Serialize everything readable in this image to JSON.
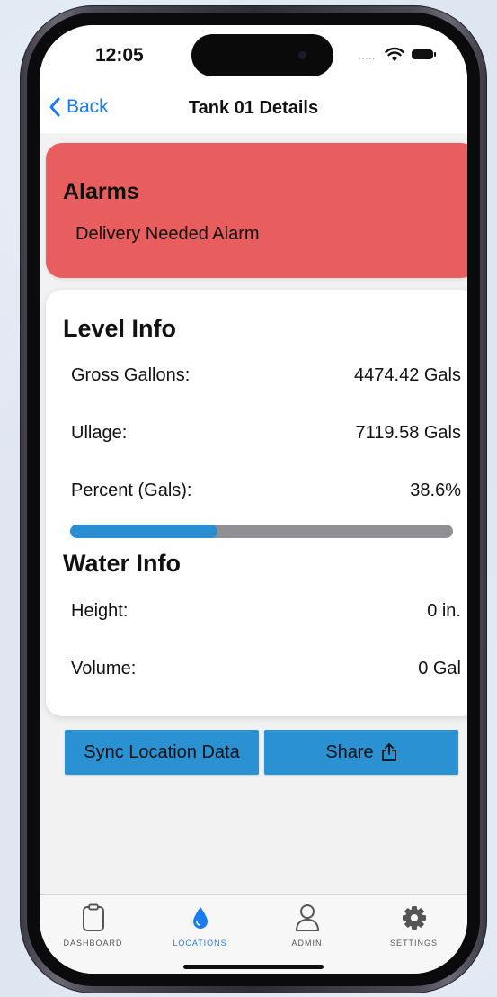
{
  "status_bar": {
    "time": "12:05",
    "signal_dots": "....."
  },
  "nav": {
    "back_label": "Back",
    "title": "Tank 01 Details"
  },
  "alarms": {
    "title": "Alarms",
    "items": [
      "Delivery Needed Alarm"
    ]
  },
  "level_info": {
    "title": "Level Info",
    "rows": [
      {
        "label": "Gross Gallons:",
        "value": "4474.42 Gals"
      },
      {
        "label": "Ullage:",
        "value": "7119.58 Gals"
      },
      {
        "label": "Percent (Gals):",
        "value": "38.6%"
      }
    ],
    "percent_fill": 38.6
  },
  "water_info": {
    "title": "Water Info",
    "rows": [
      {
        "label": "Height:",
        "value": "0 in."
      },
      {
        "label": "Volume:",
        "value": "0 Gal"
      }
    ]
  },
  "actions": {
    "sync_label": "Sync Location Data",
    "share_label": "Share"
  },
  "tabs": [
    {
      "label": "Dashboard",
      "icon": "clipboard-icon",
      "active": false
    },
    {
      "label": "Locations",
      "icon": "water-drop-icon",
      "active": true
    },
    {
      "label": "Admin",
      "icon": "person-icon",
      "active": false
    },
    {
      "label": "Settings",
      "icon": "gear-icon",
      "active": false
    }
  ],
  "colors": {
    "alarm_bg": "#e85d5d",
    "accent": "#1a7cf0",
    "button": "#2a91d2",
    "progress_fill": "#2a8fd2",
    "progress_track": "#8f8f94"
  }
}
